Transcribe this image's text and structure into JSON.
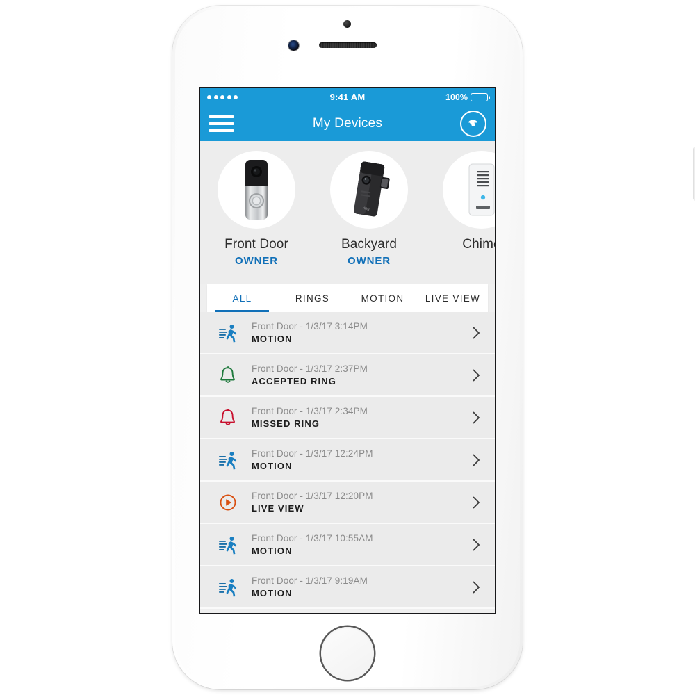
{
  "device_frame": {
    "type": "smartphone",
    "color": "silver-white",
    "buttons": [
      {
        "name": "mute-switch"
      },
      {
        "name": "volume-up-button"
      },
      {
        "name": "volume-down-button"
      },
      {
        "name": "power-button"
      },
      {
        "name": "home-button"
      }
    ],
    "sensors": [
      "front-camera",
      "earpiece-speaker",
      "proximity-sensor"
    ]
  },
  "colors": {
    "brand_blue": "#1a9ad7",
    "accent_blue": "#1170b8",
    "screen_bg": "#ebebeb",
    "row_divider": "#fafafa",
    "motion_icon": "#1a6fa8",
    "accepted_ring_icon": "#1f7a3d",
    "missed_ring_icon": "#c8102e",
    "live_view_icon": "#d94f10"
  },
  "status_bar": {
    "signal_dots": 5,
    "time": "9:41 AM",
    "battery_percent": "100%",
    "battery_level": 100
  },
  "nav_bar": {
    "menu_icon": "hamburger-menu-icon",
    "title": "My Devices",
    "logo_icon": "ring-logo-icon"
  },
  "devices": [
    {
      "name": "Front Door",
      "role": "OWNER",
      "product": "video-doorbell"
    },
    {
      "name": "Backyard",
      "role": "OWNER",
      "product": "stick-up-cam"
    },
    {
      "name": "Chime",
      "role": "",
      "product": "chime"
    }
  ],
  "tabs": [
    {
      "label": "ALL",
      "active": true
    },
    {
      "label": "RINGS",
      "active": false
    },
    {
      "label": "MOTION",
      "active": false
    },
    {
      "label": "LIVE VIEW",
      "active": false
    }
  ],
  "events": [
    {
      "meta": "Front Door - 1/3/17 3:14PM",
      "type": "MOTION",
      "icon": "motion-icon"
    },
    {
      "meta": "Front Door - 1/3/17 2:37PM",
      "type": "ACCEPTED RING",
      "icon": "bell-accepted-icon"
    },
    {
      "meta": "Front Door - 1/3/17 2:34PM",
      "type": "MISSED RING",
      "icon": "bell-missed-icon"
    },
    {
      "meta": "Front Door - 1/3/17 12:24PM",
      "type": "MOTION",
      "icon": "motion-icon"
    },
    {
      "meta": "Front Door - 1/3/17 12:20PM",
      "type": "LIVE VIEW",
      "icon": "live-view-icon"
    },
    {
      "meta": "Front Door - 1/3/17 10:55AM",
      "type": "MOTION",
      "icon": "motion-icon"
    },
    {
      "meta": "Front Door - 1/3/17 9:19AM",
      "type": "MOTION",
      "icon": "motion-icon"
    }
  ]
}
